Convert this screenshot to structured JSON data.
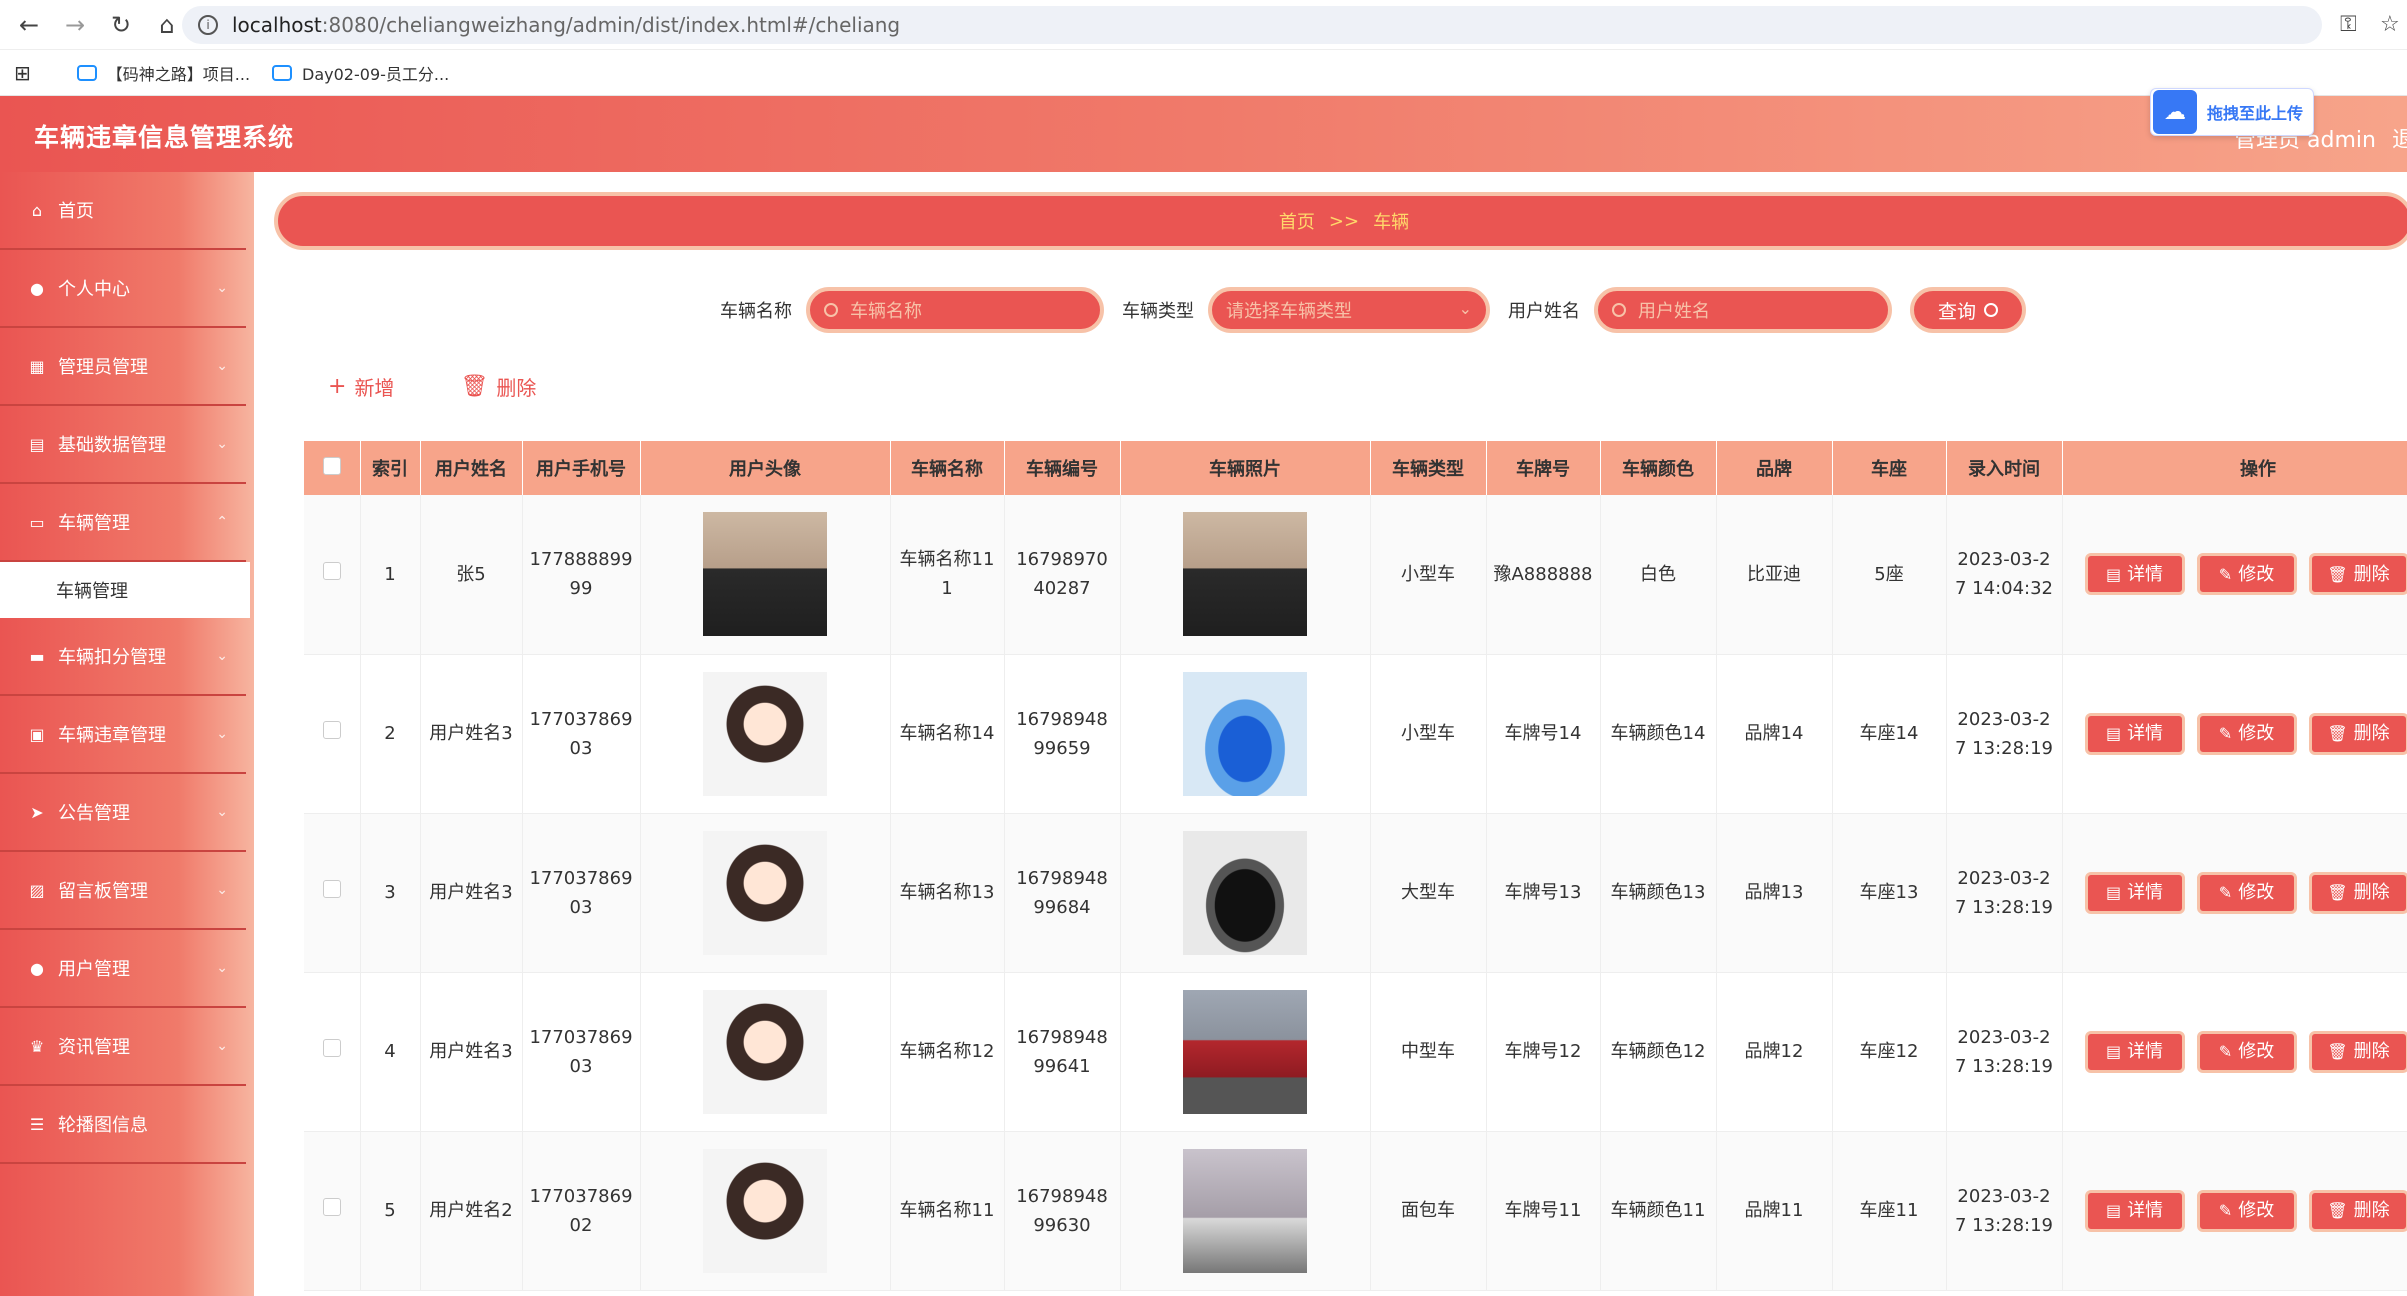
{
  "browser": {
    "url_host": "localhost",
    "url_path": ":8080/cheliangweizhang/admin/dist/index.html#/cheliang",
    "bookmarks": [
      "【码神之路】项目...",
      "Day02-09-员工分..."
    ]
  },
  "header": {
    "title": "车辆违章信息管理系统",
    "admin": "管理员 admin",
    "logout": "退",
    "upload_widget": "拖拽至此上传"
  },
  "sidebar": {
    "items": [
      {
        "label": "首页",
        "icon": "home-icon"
      },
      {
        "label": "个人中心",
        "icon": "user-icon"
      },
      {
        "label": "管理员管理",
        "icon": "grid-icon"
      },
      {
        "label": "基础数据管理",
        "icon": "database-icon"
      },
      {
        "label": "车辆管理",
        "icon": "monitor-icon"
      },
      {
        "label": "车辆扣分管理",
        "icon": "chat-icon"
      },
      {
        "label": "车辆违章管理",
        "icon": "clipboard-icon"
      },
      {
        "label": "公告管理",
        "icon": "send-icon"
      },
      {
        "label": "留言板管理",
        "icon": "message-icon"
      },
      {
        "label": "用户管理",
        "icon": "user-icon"
      },
      {
        "label": "资讯管理",
        "icon": "trophy-icon"
      },
      {
        "label": "轮播图信息",
        "icon": "sliders-icon"
      }
    ],
    "submenu": "车辆管理"
  },
  "breadcrumb": {
    "home": "首页",
    "sep": ">>",
    "current": "车辆"
  },
  "search": {
    "name_label": "车辆名称",
    "name_placeholder": "车辆名称",
    "type_label": "车辆类型",
    "type_placeholder": "请选择车辆类型",
    "user_label": "用户姓名",
    "user_placeholder": "用户姓名",
    "query": "查询"
  },
  "actions": {
    "add": "新增",
    "delete": "删除"
  },
  "table": {
    "headers": [
      "索引",
      "用户姓名",
      "用户手机号",
      "用户头像",
      "车辆名称",
      "车辆编号",
      "车辆照片",
      "车辆类型",
      "车牌号",
      "车辆颜色",
      "品牌",
      "车座",
      "录入时间",
      "操作"
    ],
    "op_labels": {
      "detail": "详情",
      "edit": "修改",
      "delete": "删除"
    },
    "rows": [
      {
        "index": "1",
        "user": "张5",
        "phone": "17788889999",
        "avatar": "photo-man",
        "name": "车辆名称111",
        "code": "1679897040287",
        "photo": "photo-man",
        "type": "小型车",
        "plate": "豫A888888",
        "color": "白色",
        "brand": "比亚迪",
        "seat": "5座",
        "time": "2023-03-27 14:04:32"
      },
      {
        "index": "2",
        "user": "用户姓名3",
        "phone": "17703786903",
        "avatar": "cartoon-girl",
        "name": "车辆名称14",
        "code": "1679894899659",
        "photo": "car-blue",
        "type": "小型车",
        "plate": "车牌号14",
        "color": "车辆颜色14",
        "brand": "品牌14",
        "seat": "车座14",
        "time": "2023-03-27 13:28:19"
      },
      {
        "index": "3",
        "user": "用户姓名3",
        "phone": "17703786903",
        "avatar": "cartoon-girl",
        "name": "车辆名称13",
        "code": "1679894899684",
        "photo": "car-black",
        "type": "大型车",
        "plate": "车牌号13",
        "color": "车辆颜色13",
        "brand": "品牌13",
        "seat": "车座13",
        "time": "2023-03-27 13:28:19"
      },
      {
        "index": "4",
        "user": "用户姓名3",
        "phone": "17703786903",
        "avatar": "cartoon-girl",
        "name": "车辆名称12",
        "code": "1679894899641",
        "photo": "car-red",
        "type": "中型车",
        "plate": "车牌号12",
        "color": "车辆颜色12",
        "brand": "品牌12",
        "seat": "车座12",
        "time": "2023-03-27 13:28:19"
      },
      {
        "index": "5",
        "user": "用户姓名2",
        "phone": "17703786902",
        "avatar": "cartoon-girl",
        "name": "车辆名称11",
        "code": "1679894899630",
        "photo": "car-silver",
        "type": "面包车",
        "plate": "车牌号11",
        "color": "车辆颜色11",
        "brand": "品牌11",
        "seat": "车座11",
        "time": "2023-03-27 13:28:19"
      }
    ]
  },
  "colors": {
    "accent": "#ea5552",
    "header_row": "#f7a48a",
    "border_light": "#f7c2a8",
    "crumb_text": "#ffd86b"
  }
}
